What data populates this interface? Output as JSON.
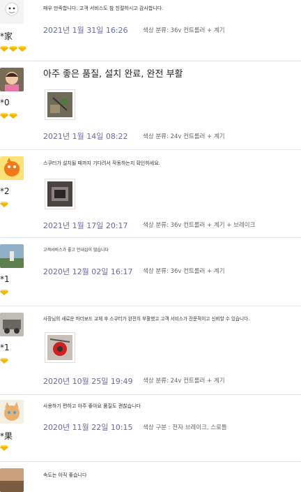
{
  "reviews": [
    {
      "user": "*家",
      "text": "매우 만족합니다. 고객 서비스도 참 친절하시고 감사합니다.",
      "date": "2021년 1월 31일 16:26",
      "spec": "색상 분류: 36v 컨트롤러 + 계기",
      "rank": 3,
      "photo": false
    },
    {
      "user": "*0",
      "text": "아주 좋은 품질, 설치 완료, 완전 부활",
      "date": "2021년 1월 14일 08:22",
      "spec": "색상 분류: 24v 컨트롤러 + 계기",
      "rank": 2,
      "photo": true
    },
    {
      "user": "*2",
      "text": "스쿠터가 설치될 때까지 기다려서 작동하는지 확인하세요.",
      "date": "2021년 1월 17일 20:17",
      "spec": "색상 분류: 36v 컨트롤러 + 계기 + 브레이크",
      "rank": 1,
      "photo": true
    },
    {
      "user": "*1",
      "text": "고객서비스가 좋고 안내심이 많습니다",
      "date": "2020년 12월 02일 16:17",
      "spec": "색상 분류: 36v 컨트롤러 + 계기",
      "rank": 1,
      "photo": false
    },
    {
      "user": "*1",
      "text": "사장님의 새로운 마더보드 교체 후 스쿠터가 완전히 부활했고 고객 서비스가 전문적이고 신뢰할 수 있습니다.",
      "date": "2020년 10월 25일 19:49",
      "spec": "색상 분류: 24v 컨트롤러 + 계기",
      "rank": 1,
      "photo": true
    },
    {
      "user": "*果",
      "text": "사용하기 편하고 아주 좋아요 품질도 괜찮습니다",
      "date": "2020년 11월 22일 10:15",
      "spec": "색상 구분 : 전자 브레이크, 스로틀",
      "rank": 1,
      "photo": false
    },
    {
      "user": "",
      "text": "속도는 아직 좋습니다",
      "date": "",
      "spec": "",
      "rank": 0,
      "photo": false
    }
  ],
  "colors": {
    "date": "#6a6aa0",
    "diamond": "#f2b705"
  }
}
